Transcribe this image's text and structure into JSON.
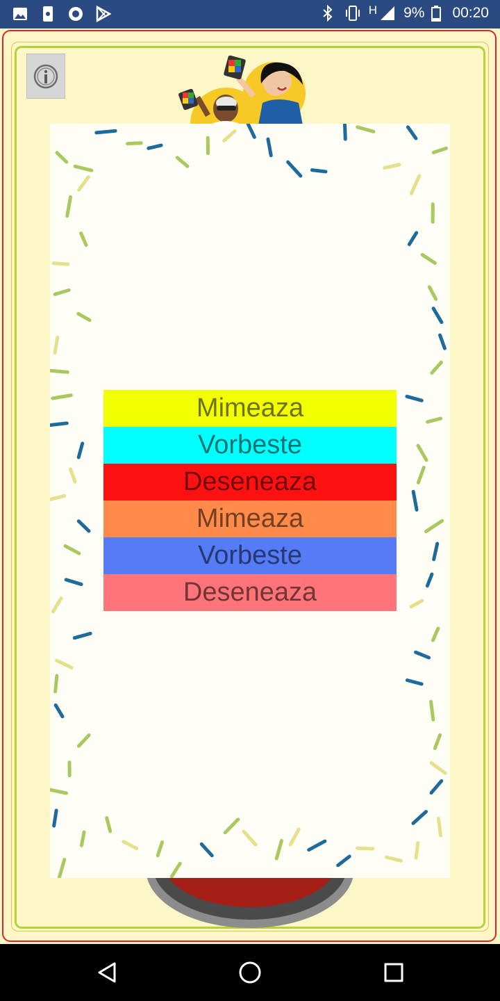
{
  "status_bar": {
    "battery": "9%",
    "network": "H",
    "time": "00:20"
  },
  "options": [
    {
      "label": "Mimeaza",
      "color": "#f2ff00"
    },
    {
      "label": "Vorbeste",
      "color": "#00ffff"
    },
    {
      "label": "Deseneaza",
      "color": "#ff1111"
    },
    {
      "label": "Mimeaza",
      "color": "#ff8a4a"
    },
    {
      "label": "Vorbeste",
      "color": "#557cf6"
    },
    {
      "label": "Deseneaza",
      "color": "#ff7479"
    }
  ],
  "icons": {
    "info": "info-icon",
    "back": "back-triangle-icon",
    "home": "home-circle-icon",
    "recents": "recents-square-icon"
  },
  "colors": {
    "background": "#fdf6c6",
    "frame_outer": "#e0222a",
    "frame_inner": "#b3d336",
    "card": "#fefef7",
    "confetti_blue": "#1e6a9a",
    "confetti_green": "#a9c95e",
    "confetti_yellow": "#e6e08c"
  }
}
